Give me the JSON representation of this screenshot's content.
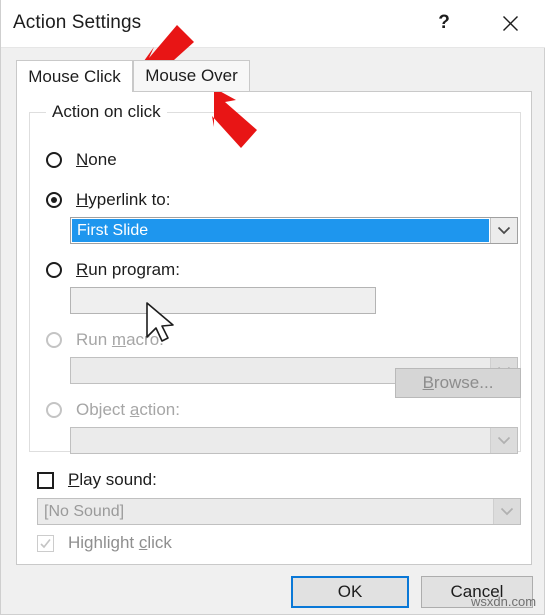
{
  "window": {
    "title": "Action Settings",
    "help_icon": "question-mark-icon",
    "close_icon": "close-x-icon"
  },
  "tabs": [
    {
      "id": "mouse-click",
      "label": "Mouse Click",
      "active": true
    },
    {
      "id": "mouse-over",
      "label": "Mouse Over",
      "active": false
    }
  ],
  "group": {
    "label": "Action on click"
  },
  "options": [
    {
      "id": "none",
      "label": "None",
      "accel": "N",
      "selected": false,
      "enabled": true
    },
    {
      "id": "hyperlink-to",
      "label": "Hyperlink to:",
      "accel": "H",
      "selected": true,
      "enabled": true,
      "combo_value": "First Slide",
      "combo_state": "selected"
    },
    {
      "id": "run-program",
      "label": "Run program:",
      "accel": "R",
      "selected": false,
      "enabled": true,
      "input_value": "",
      "browse_label": "Browse...",
      "browse_accel": "B",
      "browse_enabled": false
    },
    {
      "id": "run-macro",
      "label": "Run macro:",
      "accel": "m",
      "selected": false,
      "enabled": false,
      "combo_value": "",
      "combo_state": "disabled"
    },
    {
      "id": "object-action",
      "label": "Object action:",
      "accel": "a",
      "selected": false,
      "enabled": false,
      "combo_value": "",
      "combo_state": "disabled"
    }
  ],
  "play_sound": {
    "label": "Play sound:",
    "accel": "P",
    "checked": false,
    "enabled": true,
    "combo_value": "[No Sound]",
    "combo_enabled": false
  },
  "highlight_click": {
    "label": "Highlight click",
    "accel": "c",
    "checked": true,
    "enabled": false
  },
  "footer": {
    "ok_label": "OK",
    "cancel_label": "Cancel"
  },
  "annotations": {
    "arrow_color": "#e81515",
    "arrow_1_target": "mouse-click-tab",
    "arrow_2_target": "mouse-over-tab"
  },
  "watermark": "wsxdn.com",
  "colors": {
    "selection_blue": "#1e96ee",
    "focus_blue": "#0a78d7",
    "annotation_red": "#e81515"
  }
}
